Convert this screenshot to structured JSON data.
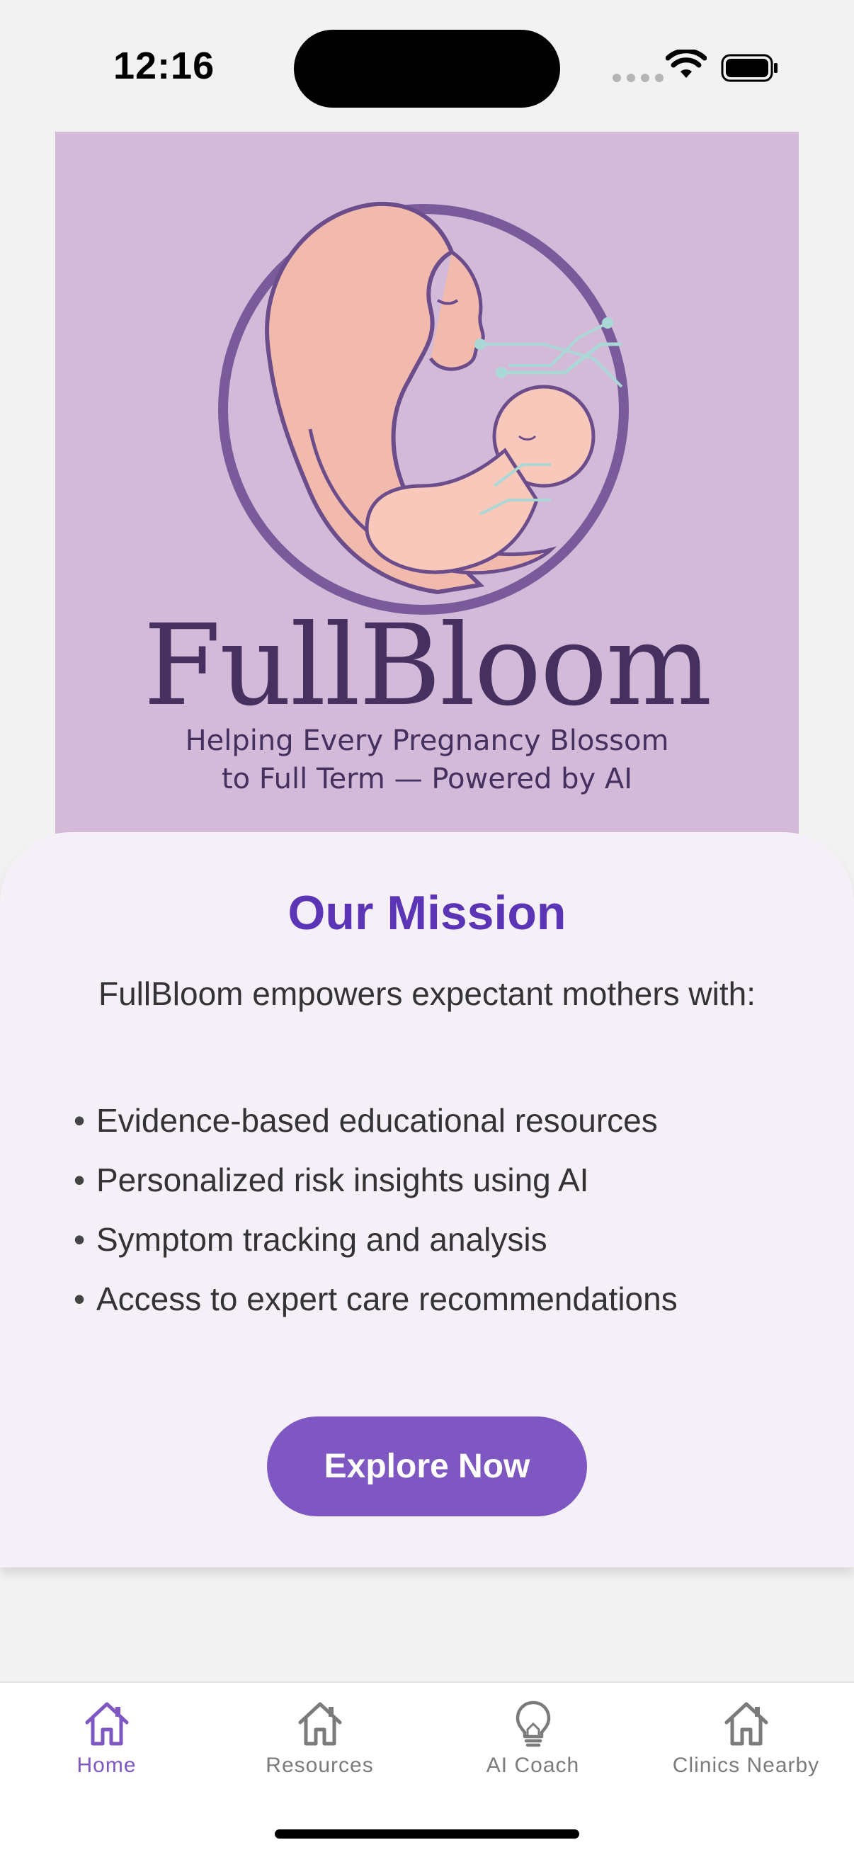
{
  "status_bar": {
    "time": "12:16"
  },
  "hero": {
    "brand": "FullBloom",
    "tagline_line1": "Helping Every Pregnancy Blossom",
    "tagline_line2": "to Full Term — Powered by AI",
    "icon": "mother-and-baby-logo-icon",
    "background_color": "#d4bad9"
  },
  "mission": {
    "title": "Our Mission",
    "intro": "FullBloom empowers expectant mothers with:",
    "bullet_symbol": "•",
    "items": [
      "Evidence-based educational resources",
      "Personalized risk insights using AI",
      "Symptom tracking and analysis",
      "Access to expert care recommendations"
    ],
    "button_label": "Explore Now",
    "accent_color": "#7e57c2"
  },
  "tabs": [
    {
      "label": "Home",
      "icon": "home-icon",
      "active": true
    },
    {
      "label": "Resources",
      "icon": "home-icon",
      "active": false
    },
    {
      "label": "AI Coach",
      "icon": "lightbulb-icon",
      "active": false
    },
    {
      "label": "Clinics Nearby",
      "icon": "home-icon",
      "active": false
    }
  ]
}
